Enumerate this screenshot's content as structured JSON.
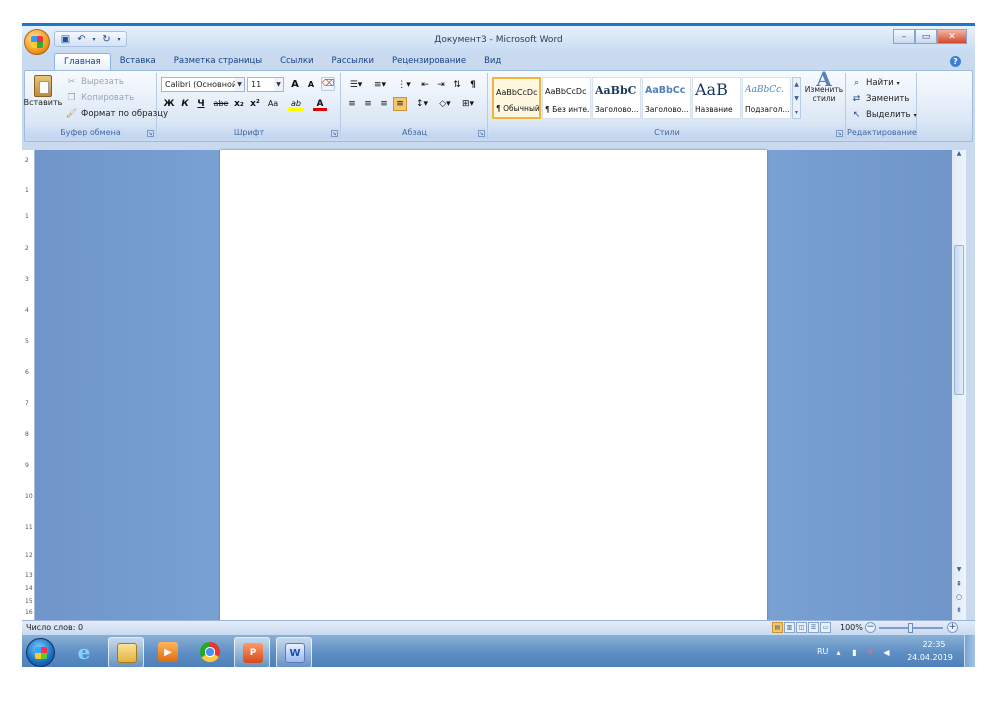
{
  "window": {
    "title": "Документ3 - Microsoft Word"
  },
  "tabs": [
    "Главная",
    "Вставка",
    "Разметка страницы",
    "Ссылки",
    "Рассылки",
    "Рецензирование",
    "Вид"
  ],
  "clipboard": {
    "label": "Буфер обмена",
    "paste": "Вставить",
    "cut": "Вырезать",
    "copy": "Копировать",
    "format_painter": "Формат по образцу"
  },
  "font": {
    "label": "Шрифт",
    "name": "Calibri (Основной тe",
    "size": "11",
    "bold": "Ж",
    "italic": "К",
    "underline": "Ч",
    "strike": "abe",
    "subscript": "x₂",
    "superscript": "x²",
    "change_case": "Aa",
    "grow": "A",
    "shrink": "A",
    "highlight": "ab",
    "color": "A"
  },
  "paragraph": {
    "label": "Абзац"
  },
  "styles": {
    "label": "Стили",
    "tiles": [
      {
        "sample": "AaBbCcDc",
        "name": "¶ Обычный"
      },
      {
        "sample": "AaBbCcDc",
        "name": "¶ Без инте..."
      },
      {
        "sample": "AaBbC",
        "name": "Заголово..."
      },
      {
        "sample": "AaBbCc",
        "name": "Заголово..."
      },
      {
        "sample": "AaB",
        "name": "Название"
      },
      {
        "sample": "AaBbCc.",
        "name": "Подзагол..."
      }
    ],
    "change": "Изменить стили"
  },
  "editing": {
    "label": "Редактирование",
    "find": "Найти",
    "replace": "Заменить",
    "select": "Выделить"
  },
  "ruler_ticks": [
    "2",
    "1",
    "1",
    "2",
    "3",
    "4",
    "5",
    "6",
    "7",
    "8",
    "9",
    "10",
    "11",
    "12",
    "13",
    "14",
    "15",
    "16"
  ],
  "status": {
    "word_count": "Число слов: 0",
    "zoom": "100%"
  },
  "tray": {
    "lang": "RU",
    "time": "22:35",
    "date": "24.04.2019"
  },
  "colors": {
    "accent": "#1c79c7",
    "highlight": "#ffff00",
    "font_color": "#e00000"
  }
}
